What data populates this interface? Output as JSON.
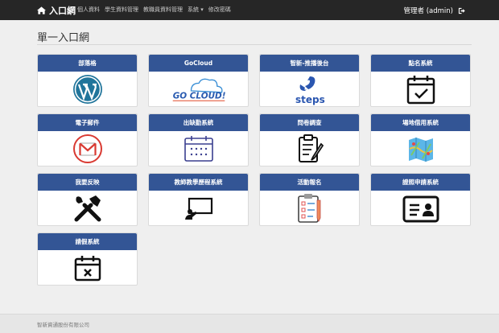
{
  "navbar": {
    "brand": "入口網",
    "items": [
      "個人資料",
      "學生資料管理",
      "教職員資料管理",
      "系統 ▾",
      "修改密碼"
    ],
    "user": "管理者 (admin)"
  },
  "page": {
    "title": "單一入口網"
  },
  "cards": [
    {
      "label": "部落格",
      "icon": "wordpress-icon"
    },
    {
      "label": "GoCloud",
      "icon": "gocloud-logo",
      "logo_text": "GO CLOUD!"
    },
    {
      "label": "智新-推播後台",
      "icon": "steps-logo",
      "logo_text": "steps"
    },
    {
      "label": "點名系統",
      "icon": "calendar-check-icon"
    },
    {
      "label": "電子郵件",
      "icon": "gmail-icon"
    },
    {
      "label": "出缺勤系統",
      "icon": "calendar-icon"
    },
    {
      "label": "問卷調查",
      "icon": "clipboard-survey-icon"
    },
    {
      "label": "場地借用系統",
      "icon": "map-icon"
    },
    {
      "label": "我要反映",
      "icon": "tools-icon"
    },
    {
      "label": "教師教學歷程系統",
      "icon": "teacher-board-icon"
    },
    {
      "label": "活動報名",
      "icon": "checklist-icon"
    },
    {
      "label": "證照申請系統",
      "icon": "id-card-icon"
    },
    {
      "label": "請假系統",
      "icon": "calendar-x-icon"
    }
  ],
  "footer": {
    "text": "智新資通股份有限公司"
  },
  "colors": {
    "navbar": "#262626",
    "card_header": "#335595",
    "background": "#efefef"
  }
}
